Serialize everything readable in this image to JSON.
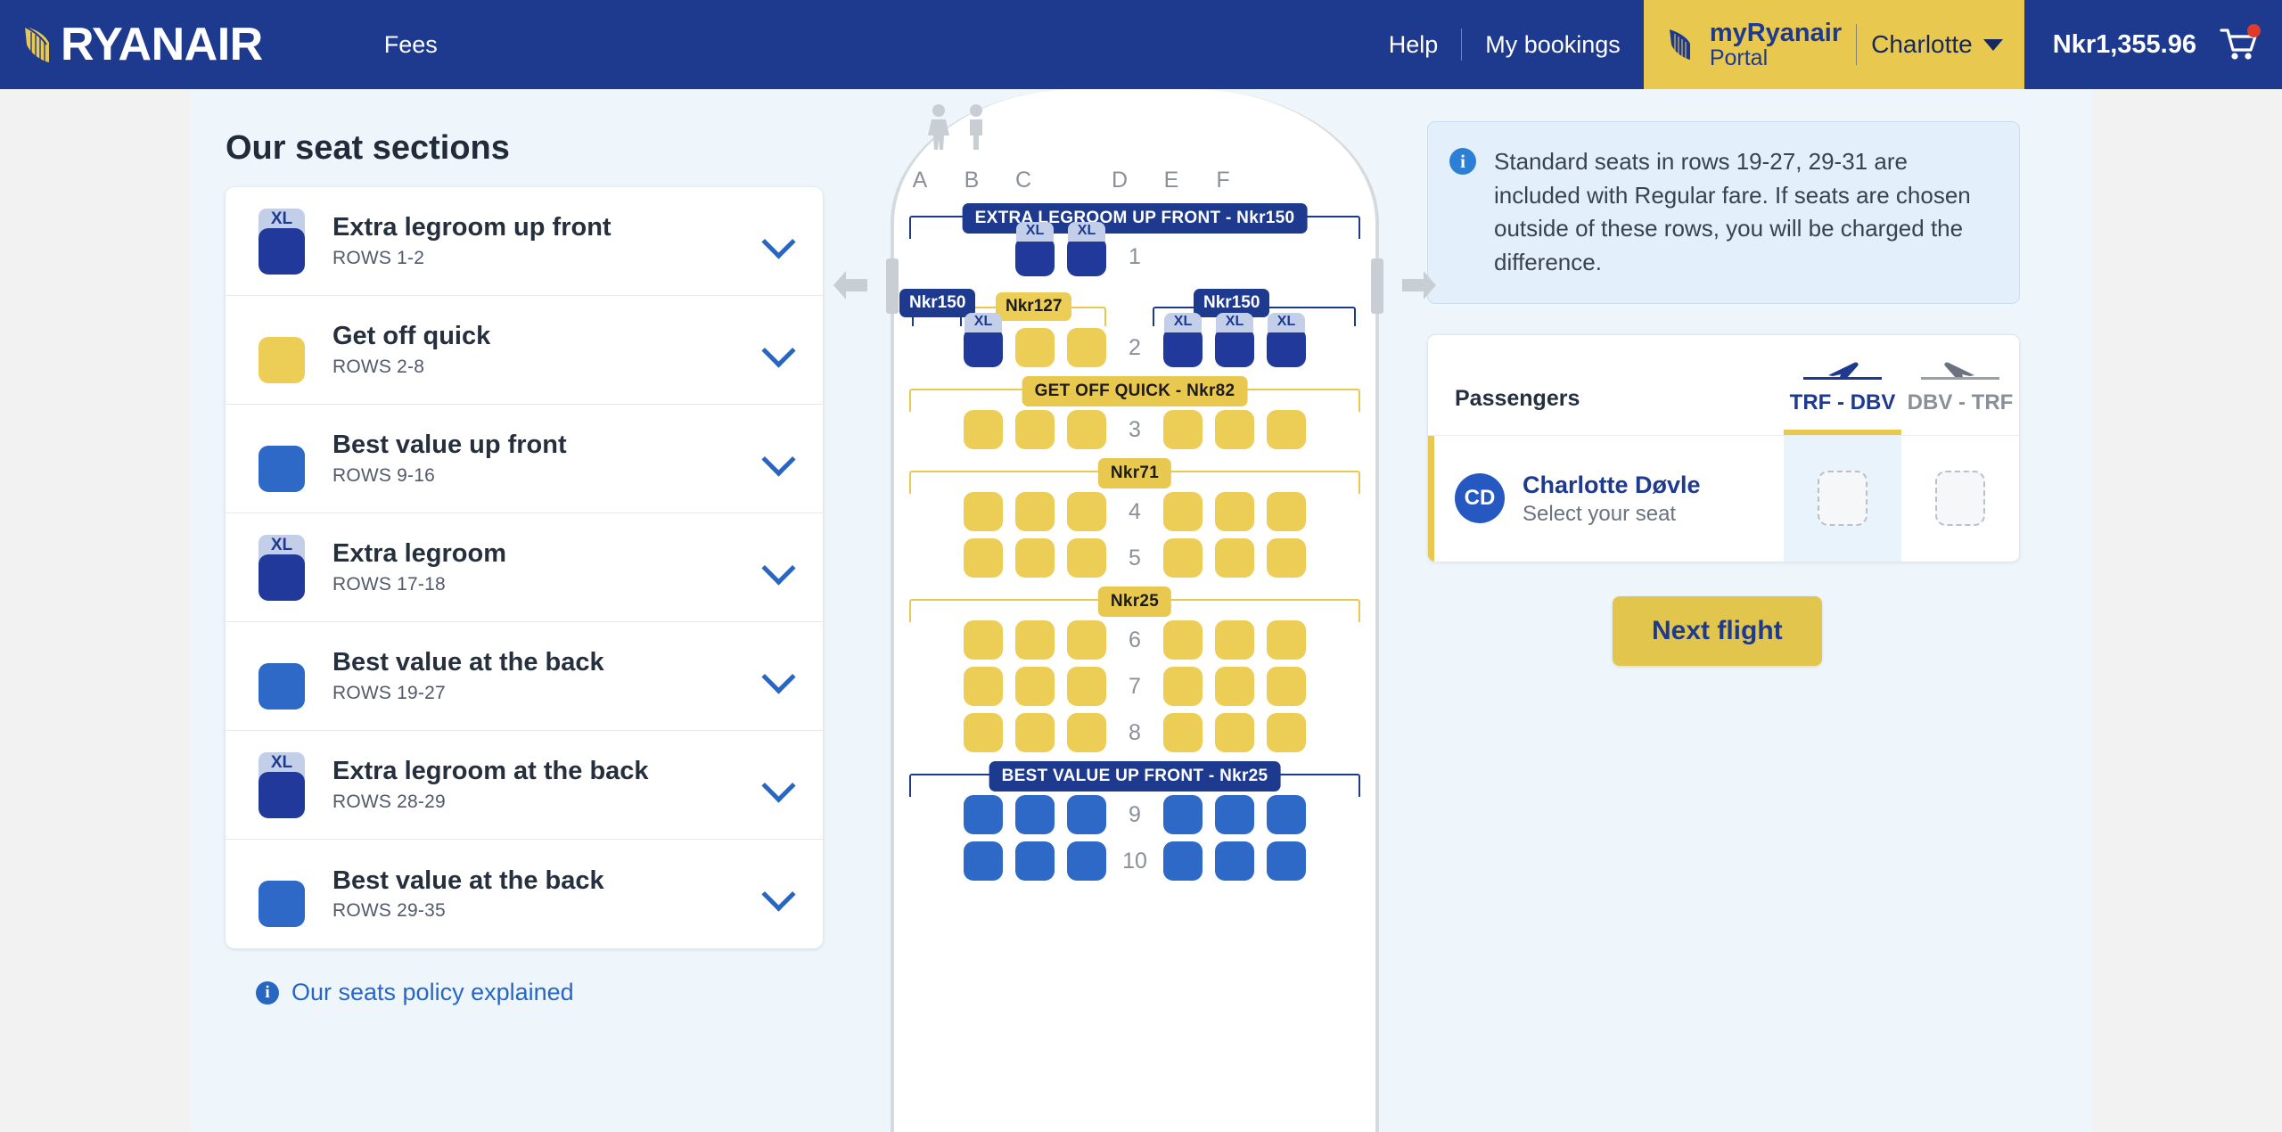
{
  "header": {
    "brand": "RYANAIR",
    "nav_left": [
      "Fees"
    ],
    "nav_right": [
      "Help",
      "My bookings"
    ],
    "portal_line1": "myRyanair",
    "portal_line2": "Portal",
    "portal_user": "Charlotte",
    "balance": "Nkr1,355.96",
    "cart_icon": "shopping-cart-icon"
  },
  "sidebar": {
    "title": "Our seat sections",
    "items": [
      {
        "name": "Extra legroom up front",
        "rows": "ROWS 1-2",
        "color": "#20399b",
        "xl": true,
        "xl_label": "XL"
      },
      {
        "name": "Get off quick",
        "rows": "ROWS 2-8",
        "color": "#eccd56",
        "xl": false,
        "xl_label": ""
      },
      {
        "name": "Best value up front",
        "rows": "ROWS 9-16",
        "color": "#2f69c8",
        "xl": false,
        "xl_label": ""
      },
      {
        "name": "Extra legroom",
        "rows": "ROWS 17-18",
        "color": "#20399b",
        "xl": true,
        "xl_label": "XL"
      },
      {
        "name": "Best value at the back",
        "rows": "ROWS 19-27",
        "color": "#2f69c8",
        "xl": false,
        "xl_label": ""
      },
      {
        "name": "Extra legroom at the back",
        "rows": "ROWS 28-29",
        "color": "#20399b",
        "xl": true,
        "xl_label": "XL"
      },
      {
        "name": "Best value at the back",
        "rows": "ROWS 29-35",
        "color": "#2f69c8",
        "xl": false,
        "xl_label": ""
      }
    ],
    "policy_link": "Our seats policy explained",
    "policy_icon": "info-icon",
    "chevron_icon": "chevron-down-icon"
  },
  "seatmap": {
    "lavatory_icon": "lavatory-icon",
    "column_letters": [
      "A",
      "B",
      "C",
      "D",
      "E",
      "F"
    ],
    "exit_left_icon": "exit-arrow-left-icon",
    "exit_right_icon": "exit-arrow-right-icon",
    "bands": {
      "extra_legroom_up_front": "EXTRA LEGROOM UP FRONT - Nkr150",
      "get_off_quick": "GET OFF QUICK - Nkr82",
      "price_71": "Nkr71",
      "price_25": "Nkr25",
      "best_value_up_front": "BEST VALUE UP FRONT - Nkr25"
    },
    "row2_callouts": {
      "left_navy": "Nkr150",
      "mid_gold": "Nkr127",
      "right_navy": "Nkr150"
    },
    "rows": [
      {
        "num": "1",
        "seats": [
          "empty",
          "dark-xl",
          "dark-xl",
          "empty",
          "empty",
          "empty"
        ]
      },
      {
        "num": "2",
        "seats": [
          "dark-xl",
          "yellow",
          "yellow",
          "dark-xl",
          "dark-xl",
          "dark-xl"
        ]
      },
      {
        "num": "3",
        "seats": [
          "yellow",
          "yellow",
          "yellow",
          "yellow",
          "yellow",
          "yellow"
        ]
      },
      {
        "num": "4",
        "seats": [
          "yellow",
          "yellow",
          "yellow",
          "yellow",
          "yellow",
          "yellow"
        ]
      },
      {
        "num": "5",
        "seats": [
          "yellow",
          "yellow",
          "yellow",
          "yellow",
          "yellow",
          "yellow"
        ]
      },
      {
        "num": "6",
        "seats": [
          "yellow",
          "yellow",
          "yellow",
          "yellow",
          "yellow",
          "yellow"
        ]
      },
      {
        "num": "7",
        "seats": [
          "yellow",
          "yellow",
          "yellow",
          "yellow",
          "yellow",
          "yellow"
        ]
      },
      {
        "num": "8",
        "seats": [
          "yellow",
          "yellow",
          "yellow",
          "yellow",
          "yellow",
          "yellow"
        ]
      },
      {
        "num": "9",
        "seats": [
          "blue",
          "blue",
          "blue",
          "blue",
          "blue",
          "blue"
        ]
      },
      {
        "num": "10",
        "seats": [
          "blue",
          "blue",
          "blue",
          "blue",
          "blue",
          "blue"
        ]
      }
    ],
    "xl_label": "XL"
  },
  "right": {
    "info_text": "Standard seats in rows 19-27, 29-31 are included with Regular fare. If seats are chosen outside of these rows, you will be charged the difference.",
    "info_icon": "info-icon",
    "passengers_label": "Passengers",
    "flights": [
      {
        "code": "TRF - DBV",
        "icon": "plane-departure-icon",
        "active": true
      },
      {
        "code": "DBV - TRF",
        "icon": "plane-arrival-icon",
        "active": false
      }
    ],
    "passenger": {
      "initials": "CD",
      "name": "Charlotte Døvle",
      "status": "Select your seat"
    },
    "next_button": "Next flight"
  },
  "colors": {
    "brand_navy": "#1e3a8f",
    "brand_yellow": "#e8c84f",
    "seat_dark": "#20399b",
    "seat_yellow": "#eccd56",
    "seat_blue": "#2f69c8"
  }
}
